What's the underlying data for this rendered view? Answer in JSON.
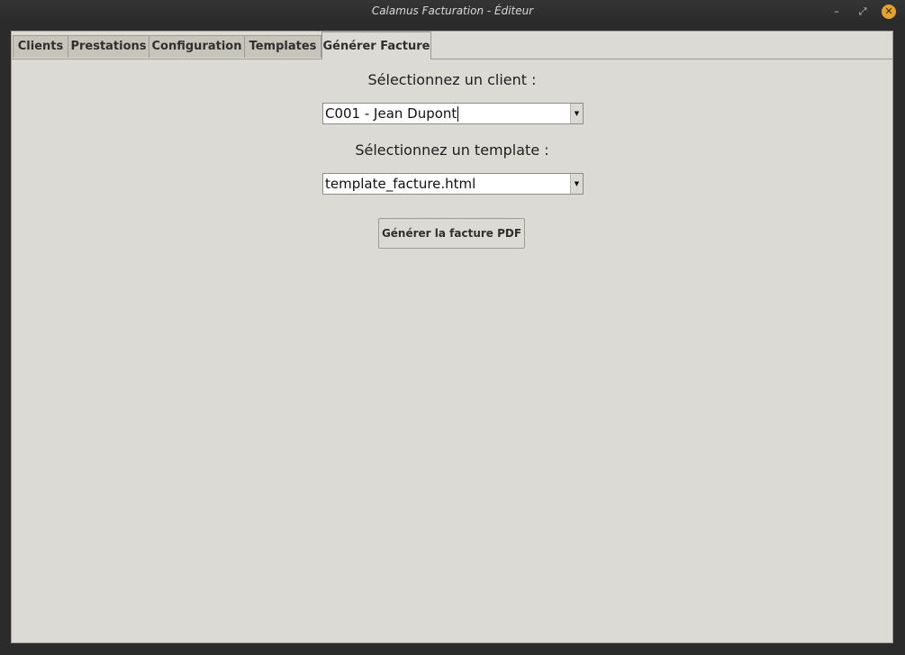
{
  "window": {
    "title": "Calamus Facturation - Éditeur",
    "minimize_glyph": "–",
    "maximize_glyph": "⤢",
    "close_glyph": "✕"
  },
  "tabs": [
    {
      "label": "Clients"
    },
    {
      "label": "Prestations"
    },
    {
      "label": "Configuration"
    },
    {
      "label": "Templates"
    },
    {
      "label": "Générer Facture",
      "active": true
    }
  ],
  "form": {
    "client_label": "Sélectionnez un client :",
    "client_value": "C001 - Jean Dupont",
    "template_label": "Sélectionnez un template :",
    "template_value": "template_facture.html",
    "generate_button": "Générer la facture PDF",
    "dropdown_arrow": "▼"
  }
}
